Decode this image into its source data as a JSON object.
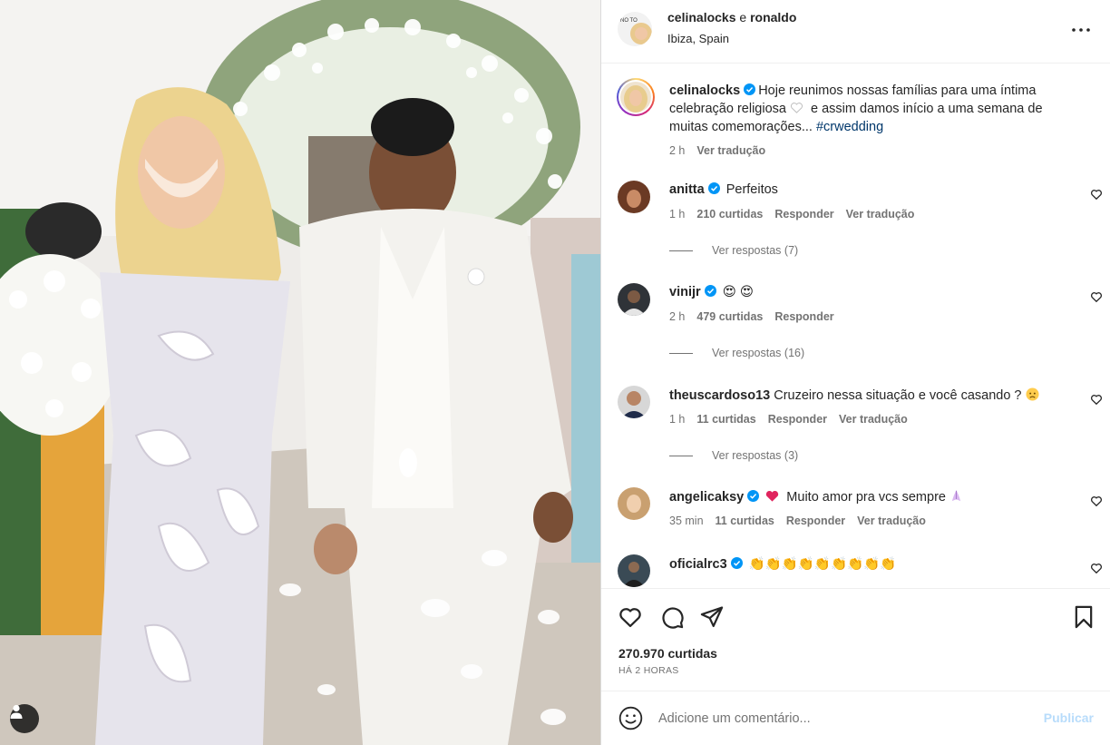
{
  "header": {
    "username": "celinalocks",
    "connector": " e ",
    "collab": "ronaldo",
    "location": "Ibiza, Spain",
    "avatar_label": "NO TO"
  },
  "caption": {
    "username": "celinalocks",
    "text_part1": "Hoje reunimos nossas famílias para uma íntima celebração religiosa ",
    "text_part2": " e assim damos início a uma semana de muitas comemorações... ",
    "hashtag": "#crwedding",
    "time": "2 h",
    "translate": "Ver tradução"
  },
  "comments": [
    {
      "username": "anitta",
      "text": "Perfeitos",
      "time": "1 h",
      "likes": "210 curtidas",
      "reply": "Responder",
      "translate": "Ver tradução",
      "replies": "Ver respostas (7)"
    },
    {
      "username": "vinijr",
      "text": "😍 😍",
      "time": "2 h",
      "likes": "479 curtidas",
      "reply": "Responder",
      "translate": "",
      "replies": "Ver respostas (16)"
    },
    {
      "username": "theuscardoso13",
      "text": "Cruzeiro nessa situação e você casando ?",
      "time": "1 h",
      "likes": "11 curtidas",
      "reply": "Responder",
      "translate": "Ver tradução",
      "replies": "Ver respostas (3)"
    },
    {
      "username": "angelicaksy",
      "text": "Muito amor pra vcs sempre",
      "time": "35 min",
      "likes": "11 curtidas",
      "reply": "Responder",
      "translate": "Ver tradução",
      "replies": ""
    },
    {
      "username": "oficialrc3",
      "text": "👏👏👏👏👏👏👏👏👏",
      "time": "",
      "likes": "",
      "reply": "",
      "translate": "",
      "replies": ""
    }
  ],
  "stats": {
    "likes": "270.970 curtidas",
    "posted": "HÁ 2 HORAS"
  },
  "add_comment": {
    "placeholder": "Adicione um comentário...",
    "publish": "Publicar"
  },
  "colors": {
    "verified": "#0095f6",
    "link": "#00376b",
    "muted": "#737373",
    "publish_disabled": "#b8dcfb"
  }
}
